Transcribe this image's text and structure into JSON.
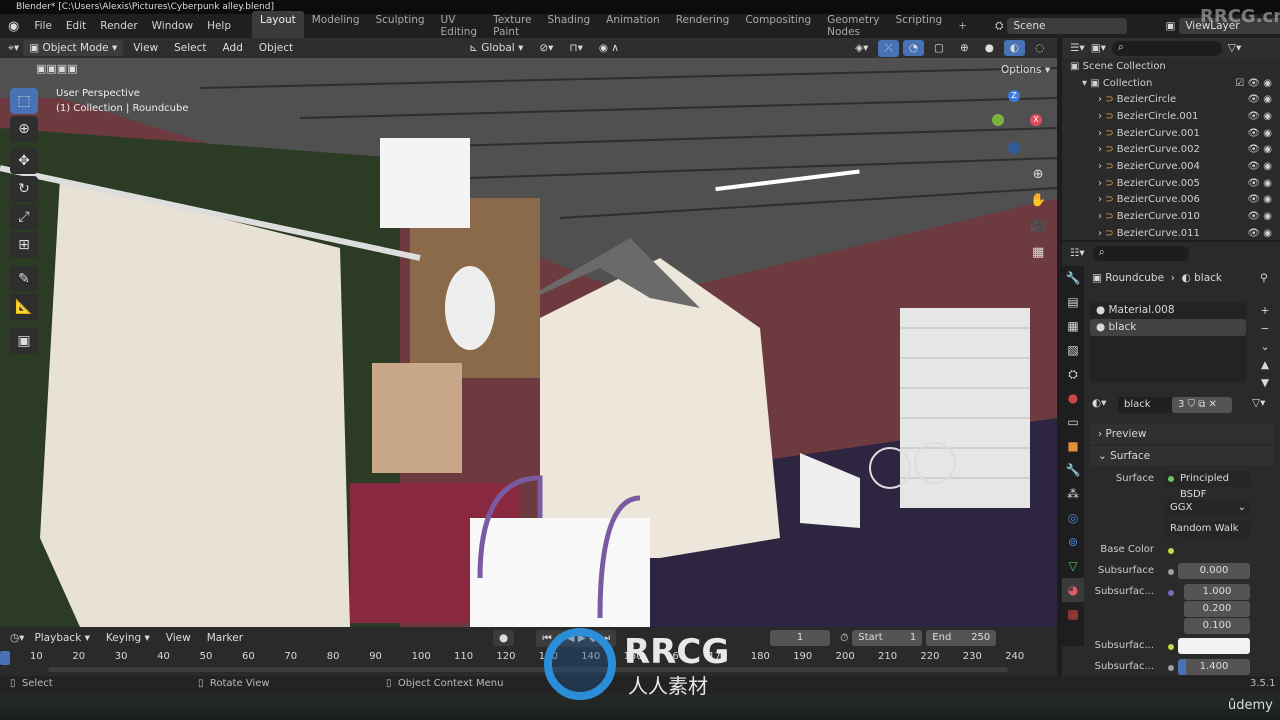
{
  "window": {
    "title": "Blender* [C:\\Users\\Alexis\\Pictures\\Cyberpunk alley.blend]"
  },
  "menu": [
    "File",
    "Edit",
    "Render",
    "Window",
    "Help"
  ],
  "workspaces": [
    {
      "label": "Layout",
      "active": true
    },
    {
      "label": "Modeling"
    },
    {
      "label": "Sculpting"
    },
    {
      "label": "UV Editing"
    },
    {
      "label": "Texture Paint"
    },
    {
      "label": "Shading"
    },
    {
      "label": "Animation"
    },
    {
      "label": "Rendering"
    },
    {
      "label": "Compositing"
    },
    {
      "label": "Geometry Nodes"
    },
    {
      "label": "Scripting"
    }
  ],
  "add_workspace": "+",
  "scene": "Scene",
  "view_layer": "ViewLayer",
  "viewport_header": {
    "mode": "Object Mode",
    "menus": [
      "View",
      "Select",
      "Add",
      "Object"
    ],
    "orientation": "Global",
    "options": "Options"
  },
  "viewport": {
    "perspective": "User Perspective",
    "collection": "(1) Collection | Roundcube",
    "gizmo_axes": [
      "Z",
      "Y",
      "X"
    ]
  },
  "outliner": {
    "root": "Scene Collection",
    "collection": "Collection",
    "items": [
      "BezierCircle",
      "BezierCircle.001",
      "BezierCurve.001",
      "BezierCurve.002",
      "BezierCurve.004",
      "BezierCurve.005",
      "BezierCurve.006",
      "BezierCurve.010",
      "BezierCurve.011"
    ]
  },
  "properties": {
    "breadcrumb": {
      "object": "Roundcube",
      "material": "black"
    },
    "slots": [
      "Material.008",
      "black"
    ],
    "material_name": "black",
    "users": "3",
    "panels": {
      "preview": "Preview",
      "surface": "Surface"
    },
    "surface_label": "Surface",
    "surface_value": "Principled BSDF",
    "distribution": "GGX",
    "subsurface_method": "Random Walk",
    "rows": [
      {
        "label": "Base Color",
        "value": ""
      },
      {
        "label": "Subsurface",
        "value": "0.000"
      },
      {
        "label": "Subsurfac...",
        "values": [
          "1.000",
          "0.200",
          "0.100"
        ]
      },
      {
        "label": "Subsurfac...",
        "value": ""
      },
      {
        "label": "Subsurfac...",
        "value": "1.400"
      }
    ],
    "colors": {
      "base_color": "#2b2b2b",
      "subsurface_color": "#f2f2f2",
      "socket_yellow": "#c8d44a",
      "socket_gray": "#a0a0a0",
      "socket_purple": "#7a6bc0"
    }
  },
  "timeline": {
    "menus": [
      "Playback",
      "Keying",
      "View",
      "Marker"
    ],
    "current_frame": "1",
    "start_label": "Start",
    "start": "1",
    "end_label": "End",
    "end": "250",
    "ticks": [
      "10",
      "20",
      "30",
      "40",
      "50",
      "60",
      "70",
      "80",
      "90",
      "100",
      "110",
      "120",
      "130",
      "140",
      "150",
      "160",
      "170",
      "180",
      "190",
      "200",
      "210",
      "220",
      "230",
      "240"
    ]
  },
  "status": {
    "select": "Select",
    "rotate": "Rotate View",
    "context": "Object Context Menu",
    "version": "3.5.1"
  },
  "watermarks": {
    "top": "RRCG.cn",
    "center": "RRCG",
    "center_sub": "人人素材",
    "udemy": "ûdemy"
  }
}
